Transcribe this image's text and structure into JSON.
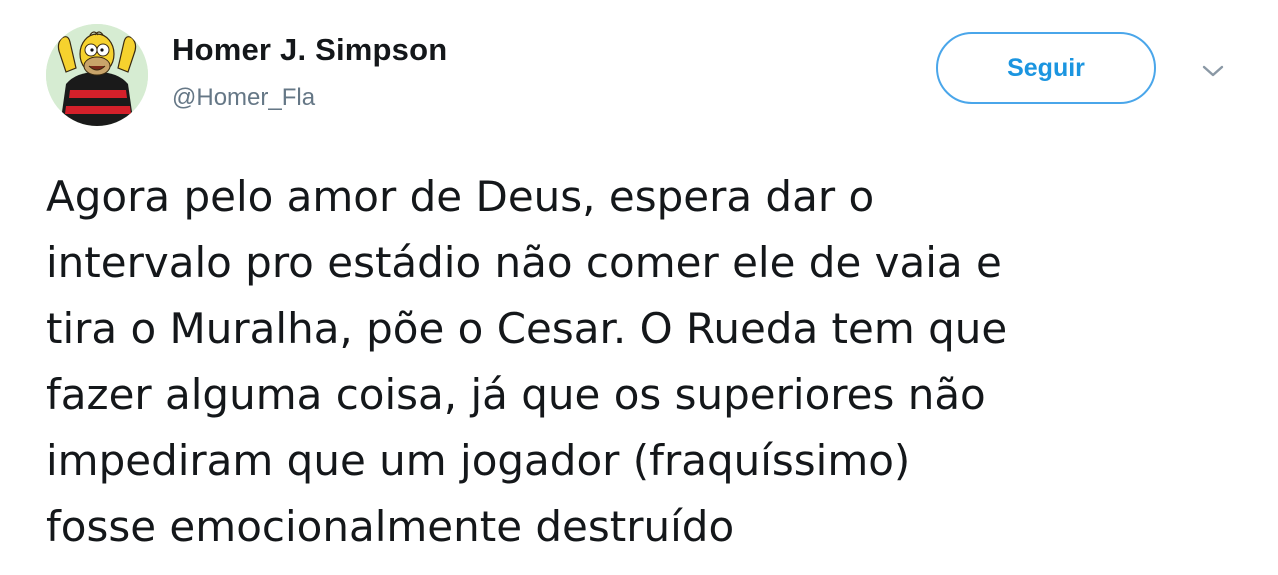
{
  "author": {
    "display_name": "Homer J. Simpson",
    "handle": "@Homer_Fla",
    "avatar_icon": "homer-simpson-avatar-icon"
  },
  "actions": {
    "follow_label": "Seguir",
    "menu_icon": "chevron-down-icon"
  },
  "tweet": {
    "lines": [
      "Agora pelo amor de Deus, espera dar o",
      "intervalo pro estádio não comer ele de vaia e",
      "tira o Muralha, põe o Cesar. O Rueda tem que",
      "fazer alguma coisa, já que os superiores não",
      "impediram que um jogador (fraquíssimo)",
      "fosse emocionalmente destruído"
    ]
  },
  "colors": {
    "accent": "#1b95e0",
    "text": "#14171a",
    "secondary": "#657786"
  }
}
